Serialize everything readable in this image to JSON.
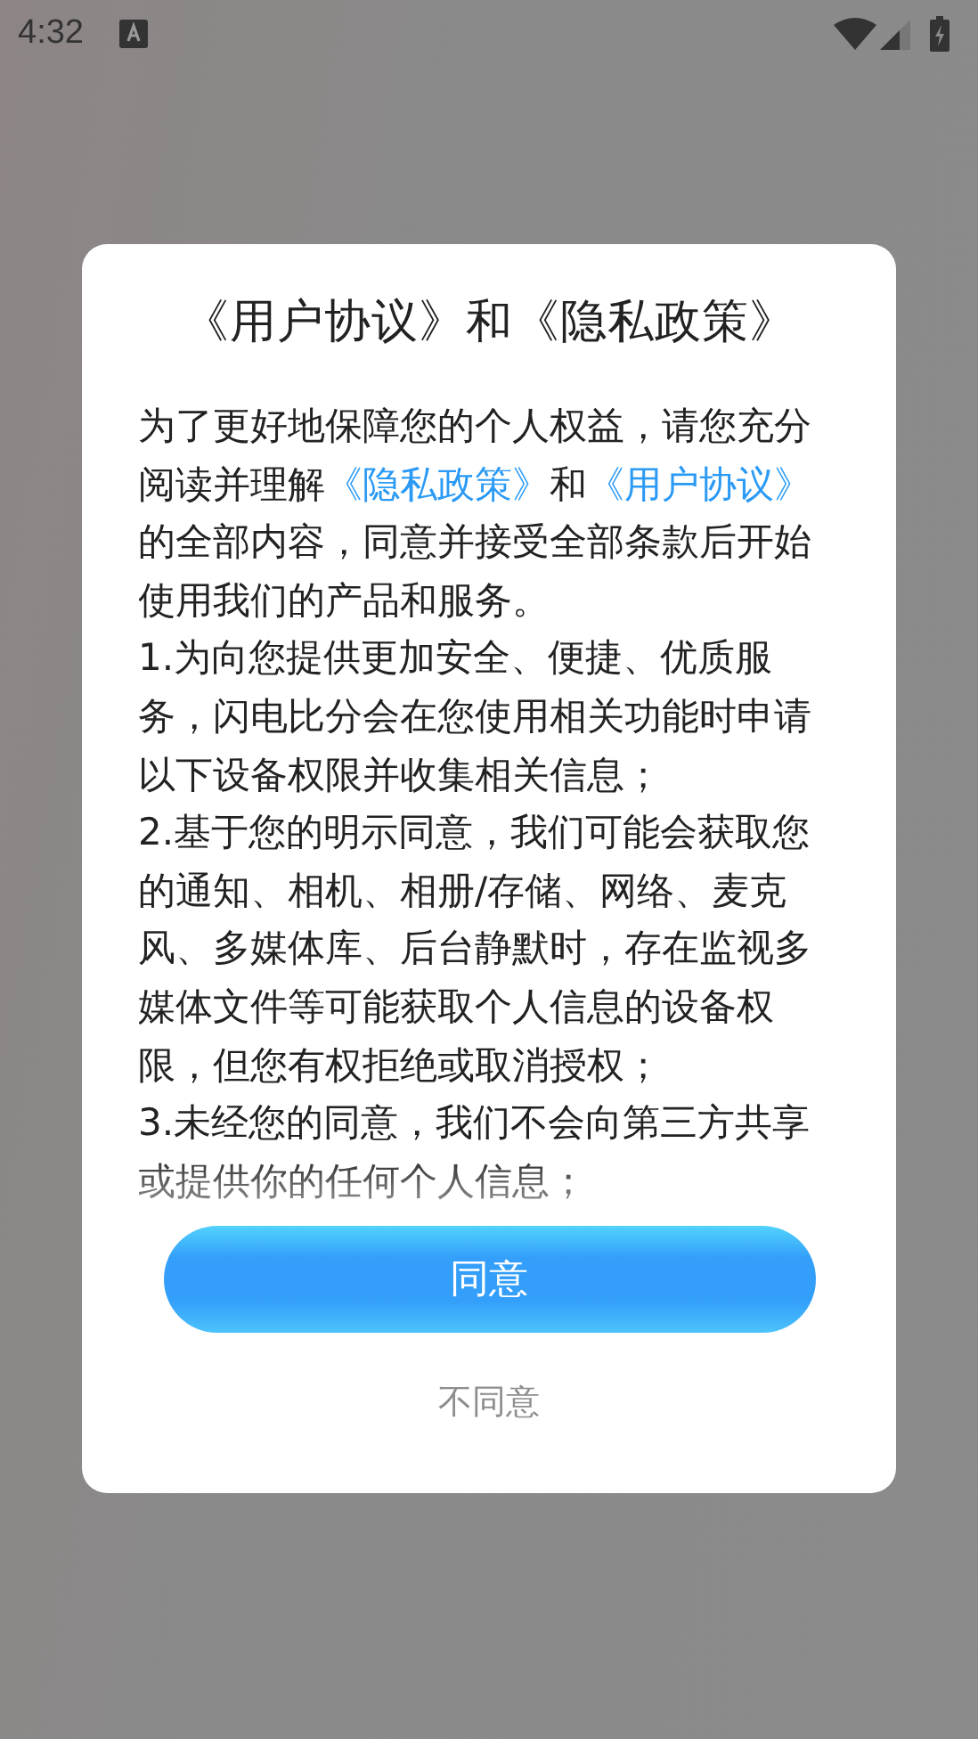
{
  "status_bar": {
    "time": "4:32"
  },
  "dialog": {
    "title": "《用户协议》和《隐私政策》",
    "paragraphs": [
      [
        {
          "kind": "text",
          "text": "为了更好地保障您的个人权益，请您充分阅读并理解"
        },
        {
          "kind": "link",
          "text": "《隐私政策》"
        },
        {
          "kind": "text",
          "text": "和"
        },
        {
          "kind": "link",
          "text": "《用户协议》"
        },
        {
          "kind": "text",
          "text": "的全部内容，同意并接受全部条款后开始使用我们的产品和服务。"
        }
      ],
      [
        {
          "kind": "text",
          "text": "1.为向您提供更加安全、便捷、优质服务，闪电比分会在您使用相关功能时申请以下设备权限并收集相关信息；"
        }
      ],
      [
        {
          "kind": "text",
          "text": "2.基于您的明示同意，我们可能会获取您的通知、相机、相册/存储、网络、麦克风、多媒体库、后台静默时，存在监视多媒体文件等可能获取个人信息的设备权限，但您有权拒绝或取消授权；"
        }
      ],
      [
        {
          "kind": "text",
          "text": "3.未经您的同意，我们不会向第三方共享或提供你的任何个人信息；"
        }
      ]
    ],
    "agree_button": "同意",
    "disagree_button": "不同意"
  }
}
